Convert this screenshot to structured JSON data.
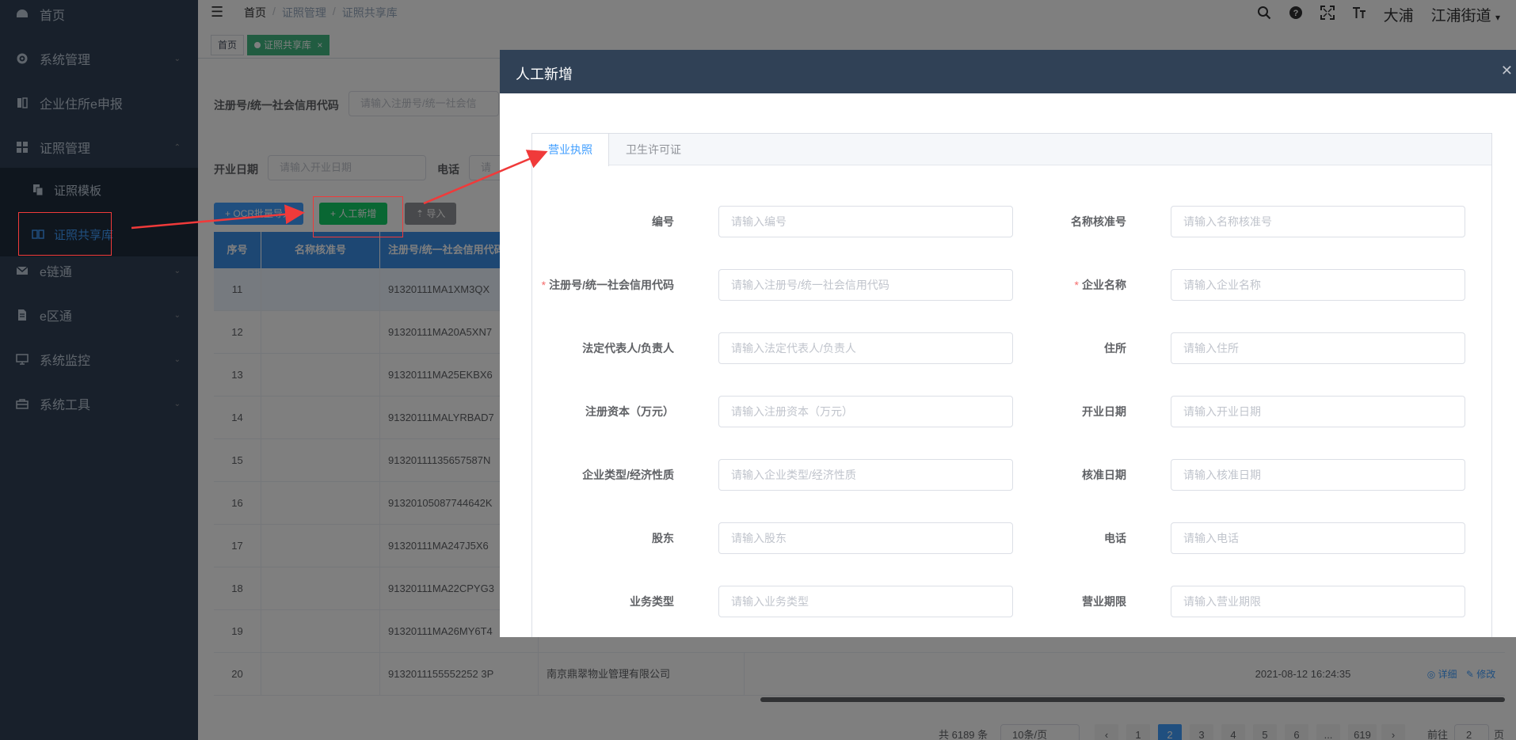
{
  "sidebar": {
    "items": [
      {
        "label": "首页",
        "icon": "dashboard-icon"
      },
      {
        "label": "系统管理",
        "icon": "gear-icon"
      },
      {
        "label": "企业住所e申报",
        "icon": "book-icon"
      },
      {
        "label": "证照管理",
        "icon": "grid-icon"
      },
      {
        "label": "e链通",
        "icon": "mail-icon"
      },
      {
        "label": "e区通",
        "icon": "document-icon"
      },
      {
        "label": "系统监控",
        "icon": "monitor-icon"
      },
      {
        "label": "系统工具",
        "icon": "toolbox-icon"
      }
    ],
    "submenu": [
      {
        "label": "证照模板",
        "icon": "copy-icon"
      },
      {
        "label": "证照共享库",
        "icon": "open-book-icon"
      }
    ]
  },
  "navbar": {
    "breadcrumb": [
      "首页",
      "证照管理",
      "证照共享库"
    ],
    "user": "大浦",
    "street": "江浦街道"
  },
  "tags": {
    "home": "首页",
    "current": "证照共享库",
    "close": "×"
  },
  "search": {
    "reg_label": "注册号/统一社会信用代码",
    "reg_placeholder": "请输入注册号/统一社会信",
    "date_label": "开业日期",
    "date_placeholder": "请输入开业日期",
    "phone_label": "电话",
    "phone_placeholder": "请"
  },
  "toolbar": {
    "ocr_label": "+ OCR批量导入",
    "manual_label": "+ 人工新增",
    "import_label": "导入"
  },
  "table": {
    "headers": [
      "序号",
      "名称核准号",
      "注册号/统一社会信用代码"
    ],
    "rows": [
      {
        "no": "11",
        "code": "91320111MA1XM3QX"
      },
      {
        "no": "12",
        "code": "91320111MA20A5XN7"
      },
      {
        "no": "13",
        "code": "91320111MA25EKBX6"
      },
      {
        "no": "14",
        "code": "91320111MALYRBAD7"
      },
      {
        "no": "15",
        "code": "91320111135657587N"
      },
      {
        "no": "16",
        "code": "91320105087744642K"
      },
      {
        "no": "17",
        "code": "91320111MA247J5X6"
      },
      {
        "no": "18",
        "code": "91320111MA22CPYG3"
      },
      {
        "no": "19",
        "code": "91320111MA26MY6T4"
      },
      {
        "no": "20",
        "code": "9132011155552252 3P",
        "name": "南京鼎翠物业管理有限公司",
        "time": "2021-08-12 16:24:35",
        "detail": "详细",
        "edit": "修改"
      }
    ]
  },
  "pagination": {
    "total": "共 6189 条",
    "size": "10条/页",
    "pages": [
      "1",
      "2",
      "3",
      "4",
      "5",
      "6",
      "...",
      "619"
    ],
    "current": "2",
    "goto_label": "前往",
    "goto_value": "2",
    "page_suffix": "页"
  },
  "dialog": {
    "title": "人工新增",
    "tabs": [
      "营业执照",
      "卫生许可证"
    ],
    "fields": [
      {
        "label": "编号",
        "placeholder": "请输入编号",
        "required": false
      },
      {
        "label": "名称核准号",
        "placeholder": "请输入名称核准号",
        "required": false
      },
      {
        "label": "注册号/统一社会信用代码",
        "placeholder": "请输入注册号/统一社会信用代码",
        "required": true
      },
      {
        "label": "企业名称",
        "placeholder": "请输入企业名称",
        "required": true
      },
      {
        "label": "法定代表人/负责人",
        "placeholder": "请输入法定代表人/负责人",
        "required": false
      },
      {
        "label": "住所",
        "placeholder": "请输入住所",
        "required": false
      },
      {
        "label": "注册资本（万元）",
        "placeholder": "请输入注册资本（万元）",
        "required": false
      },
      {
        "label": "开业日期",
        "placeholder": "请输入开业日期",
        "required": false
      },
      {
        "label": "企业类型/经济性质",
        "placeholder": "请输入企业类型/经济性质",
        "required": false
      },
      {
        "label": "核准日期",
        "placeholder": "请输入核准日期",
        "required": false
      },
      {
        "label": "股东",
        "placeholder": "请输入股东",
        "required": false
      },
      {
        "label": "电话",
        "placeholder": "请输入电话",
        "required": false
      },
      {
        "label": "业务类型",
        "placeholder": "请输入业务类型",
        "required": false
      },
      {
        "label": "营业期限",
        "placeholder": "请输入营业期限",
        "required": false
      }
    ]
  },
  "colors": {
    "sidebar": "#304156",
    "accent": "#409eff",
    "annotation": "#f03a3a"
  }
}
